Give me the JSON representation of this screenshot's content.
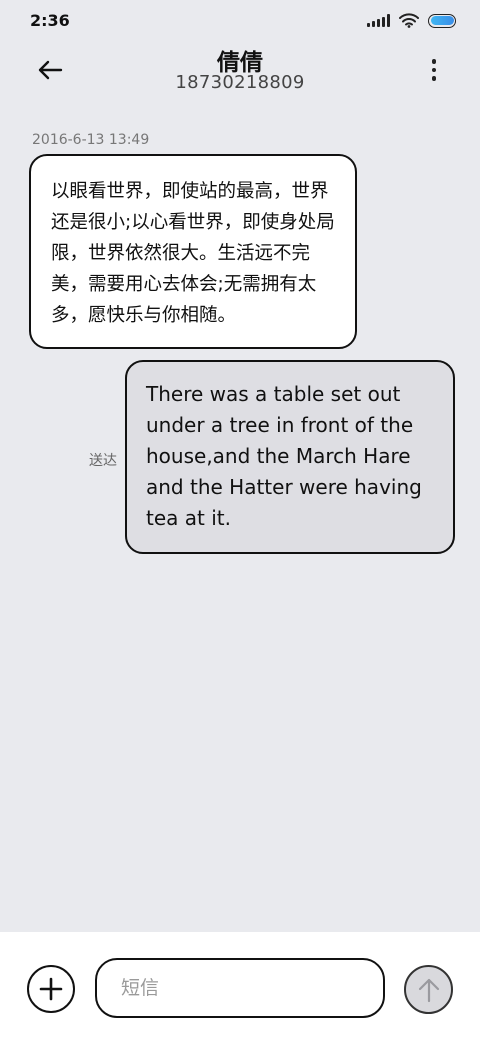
{
  "status_bar": {
    "time": "2:36",
    "icons": [
      "signal-icon",
      "wifi-icon",
      "battery-icon"
    ],
    "battery_color": "#3a8ee8"
  },
  "header": {
    "back_icon": "arrow-left-icon",
    "contact_name": "倩倩",
    "phone_number": "18730218809",
    "more_icon": "more-vertical-icon"
  },
  "conversation": {
    "timestamp": "2016-6-13 13:49",
    "messages": [
      {
        "direction": "incoming",
        "text": "以眼看世界，即使站的最高，世界还是很小;以心看世界，即使身处局限，世界依然很大。生活远不完美，需要用心去体会;无需拥有太多，愿快乐与你相随。"
      },
      {
        "direction": "outgoing",
        "text": "There was a table set out under a tree in front of the house,and the March Hare and the Hatter were having tea at it.",
        "status": "送达"
      }
    ]
  },
  "input_bar": {
    "add_icon": "plus-circle-icon",
    "placeholder": "短信",
    "value": "",
    "send_icon": "arrow-up-icon"
  }
}
